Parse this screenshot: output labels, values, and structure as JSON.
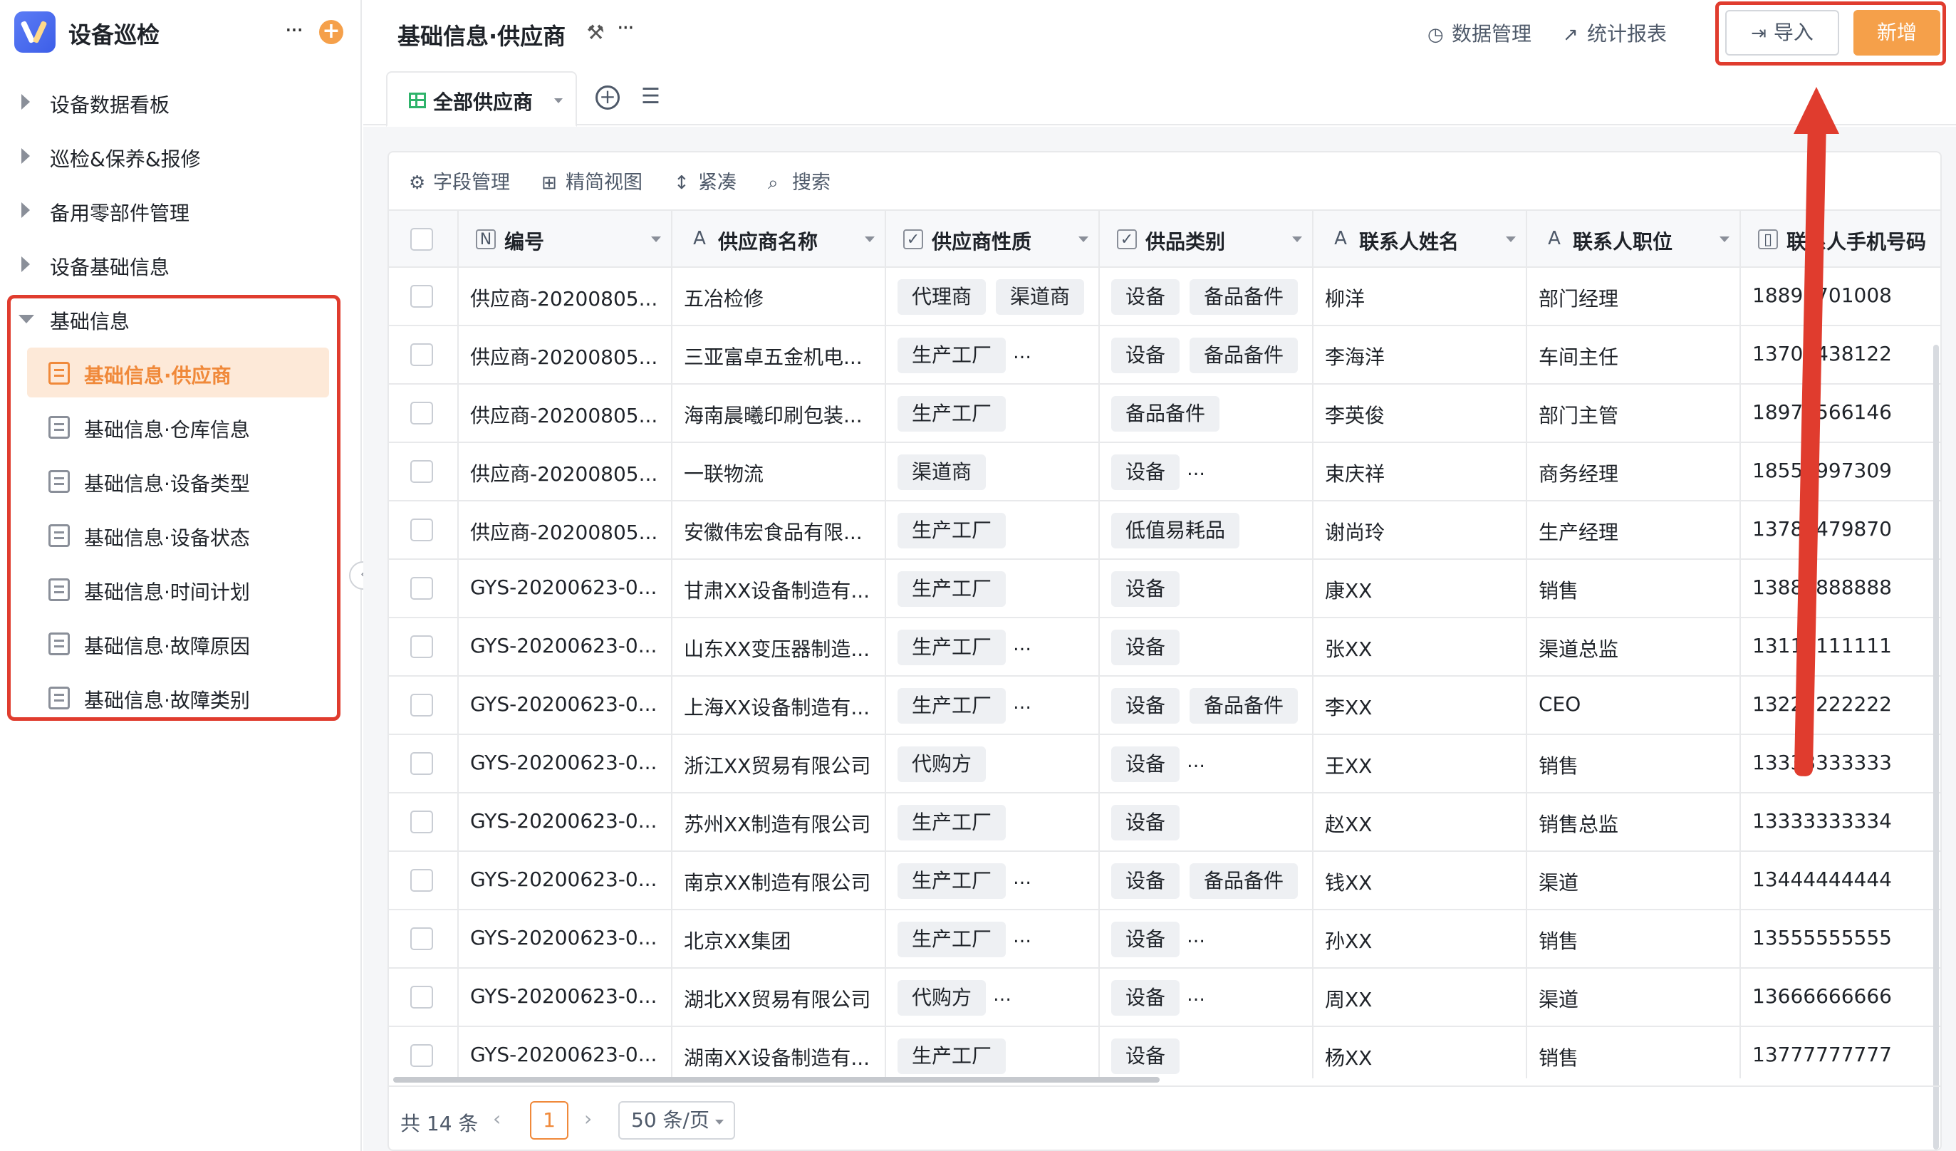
{
  "app": {
    "title": "设备巡检",
    "more": "···",
    "add": "+"
  },
  "sidebar": {
    "items": [
      {
        "label": "设备数据看板"
      },
      {
        "label": "巡检&保养&报修"
      },
      {
        "label": "备用零部件管理"
      },
      {
        "label": "设备基础信息"
      },
      {
        "label": "基础信息"
      }
    ],
    "sub_items": [
      {
        "label": "基础信息·供应商",
        "active": true
      },
      {
        "label": "基础信息·仓库信息"
      },
      {
        "label": "基础信息·设备类型"
      },
      {
        "label": "基础信息·设备状态"
      },
      {
        "label": "基础信息·时间计划"
      },
      {
        "label": "基础信息·故障原因"
      },
      {
        "label": "基础信息·故障类别"
      }
    ],
    "collapse": "‹"
  },
  "header": {
    "title": "基础信息·供应商",
    "more": "···",
    "data_manage": "数据管理",
    "stats_report": "统计报表",
    "import_label": "导入",
    "new_label": "新增"
  },
  "tabs": {
    "view_label": "全部供应商"
  },
  "toolbar": {
    "field_manage": "字段管理",
    "simple_view": "精简视图",
    "compact": "紧凑",
    "search": "搜索"
  },
  "table": {
    "columns": [
      "编号",
      "供应商名称",
      "供应商性质",
      "供品类别",
      "联系人姓名",
      "联系人职位",
      "联系人手机号码"
    ],
    "rows": [
      {
        "id": "供应商-20200805...",
        "name": "五冶检修",
        "nature": [
          "代理商",
          "渠道商"
        ],
        "nature_more": false,
        "category": [
          "设备",
          "备品备件"
        ],
        "category_more": false,
        "contact": "柳洋",
        "position": "部门经理",
        "phone": "18895701008"
      },
      {
        "id": "供应商-20200805...",
        "name": "三亚富卓五金机电...",
        "nature": [
          "生产工厂"
        ],
        "nature_more": true,
        "category": [
          "设备",
          "备品备件"
        ],
        "category_more": false,
        "contact": "李海洋",
        "position": "车间主任",
        "phone": "13700438122"
      },
      {
        "id": "供应商-20200805...",
        "name": "海南晨曦印刷包装...",
        "nature": [
          "生产工厂"
        ],
        "nature_more": false,
        "category": [
          "备品备件"
        ],
        "category_more": false,
        "contact": "李英俊",
        "position": "部门主管",
        "phone": "18976566146"
      },
      {
        "id": "供应商-20200805...",
        "name": "一联物流",
        "nature": [
          "渠道商"
        ],
        "nature_more": false,
        "category": [
          "设备"
        ],
        "category_more": true,
        "contact": "束庆祥",
        "position": "商务经理",
        "phone": "18556997309"
      },
      {
        "id": "供应商-20200805...",
        "name": "安徽伟宏食品有限...",
        "nature": [
          "生产工厂"
        ],
        "nature_more": false,
        "category": [
          "低值易耗品"
        ],
        "category_more": false,
        "contact": "谢尚玲",
        "position": "生产经理",
        "phone": "13789479870"
      },
      {
        "id": "GYS-20200623-0...",
        "name": "甘肃XX设备制造有...",
        "nature": [
          "生产工厂"
        ],
        "nature_more": false,
        "category": [
          "设备"
        ],
        "category_more": false,
        "contact": "康XX",
        "position": "销售",
        "phone": "13888888888"
      },
      {
        "id": "GYS-20200623-0...",
        "name": "山东XX变压器制造...",
        "nature": [
          "生产工厂"
        ],
        "nature_more": true,
        "category": [
          "设备"
        ],
        "category_more": false,
        "contact": "张XX",
        "position": "渠道总监",
        "phone": "13111111111"
      },
      {
        "id": "GYS-20200623-0...",
        "name": "上海XX设备制造有...",
        "nature": [
          "生产工厂"
        ],
        "nature_more": true,
        "category": [
          "设备",
          "备品备件"
        ],
        "category_more": false,
        "contact": "李XX",
        "position": "CEO",
        "phone": "13222222222"
      },
      {
        "id": "GYS-20200623-0...",
        "name": "浙江XX贸易有限公司",
        "nature": [
          "代购方"
        ],
        "nature_more": false,
        "category": [
          "设备"
        ],
        "category_more": true,
        "contact": "王XX",
        "position": "销售",
        "phone": "13333333333"
      },
      {
        "id": "GYS-20200623-0...",
        "name": "苏州XX制造有限公司",
        "nature": [
          "生产工厂"
        ],
        "nature_more": false,
        "category": [
          "设备"
        ],
        "category_more": false,
        "contact": "赵XX",
        "position": "销售总监",
        "phone": "13333333334"
      },
      {
        "id": "GYS-20200623-0...",
        "name": "南京XX制造有限公司",
        "nature": [
          "生产工厂"
        ],
        "nature_more": true,
        "category": [
          "设备",
          "备品备件"
        ],
        "category_more": false,
        "contact": "钱XX",
        "position": "渠道",
        "phone": "13444444444"
      },
      {
        "id": "GYS-20200623-0...",
        "name": "北京XX集团",
        "nature": [
          "生产工厂"
        ],
        "nature_more": true,
        "category": [
          "设备"
        ],
        "category_more": true,
        "contact": "孙XX",
        "position": "销售",
        "phone": "13555555555"
      },
      {
        "id": "GYS-20200623-0...",
        "name": "湖北XX贸易有限公司",
        "nature": [
          "代购方"
        ],
        "nature_more": true,
        "category": [
          "设备"
        ],
        "category_more": true,
        "contact": "周XX",
        "position": "渠道",
        "phone": "13666666666"
      },
      {
        "id": "GYS-20200623-0...",
        "name": "湖南XX设备制造有...",
        "nature": [
          "生产工厂"
        ],
        "nature_more": false,
        "category": [
          "设备"
        ],
        "category_more": false,
        "contact": "杨XX",
        "position": "销售",
        "phone": "13777777777"
      }
    ]
  },
  "footer": {
    "total": "共 14 条",
    "prev": "‹",
    "current_page": "1",
    "next": "›",
    "page_size": "50 条/页"
  },
  "colors": {
    "accent": "#f5a04a",
    "accent_text": "#f0893a",
    "highlight_red": "#e03c2e",
    "tag_bg": "#eef0f3"
  }
}
